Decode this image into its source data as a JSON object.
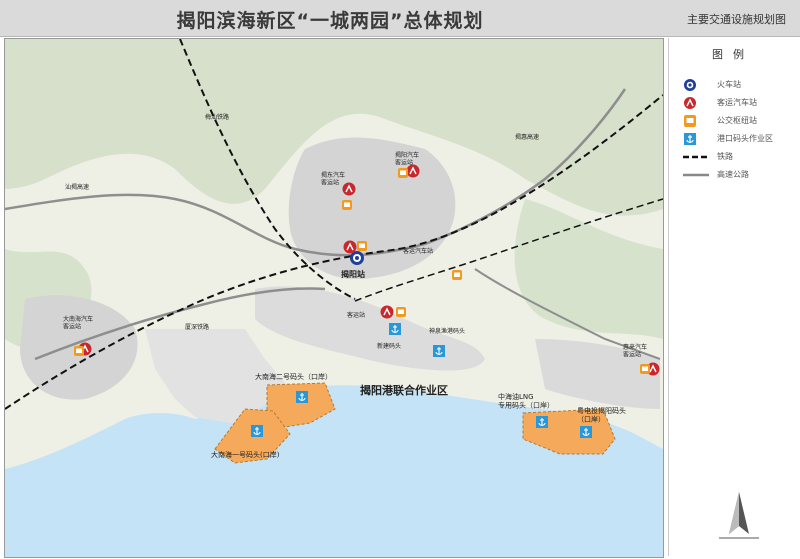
{
  "header": {
    "title": "揭阳滨海新区“一城两园”总体规划",
    "subtitle": "主要交通设施规划图"
  },
  "legend": {
    "title": "图例",
    "items": [
      {
        "id": "rail",
        "label": "火车站",
        "icon": "railway-station-icon",
        "color": "#1f3f9a"
      },
      {
        "id": "bus",
        "label": "客运汽车站",
        "icon": "bus-terminal-icon",
        "color": "#c8282d"
      },
      {
        "id": "public",
        "label": "公交枢纽站",
        "icon": "bus-hub-icon",
        "color": "#f39a1e"
      },
      {
        "id": "port",
        "label": "港口码头作业区",
        "icon": "port-anchor-icon",
        "color": "#2a98d8"
      },
      {
        "id": "railway",
        "label": "铁路",
        "icon": "railway-line-icon",
        "color": "#111111"
      },
      {
        "id": "highway",
        "label": "高速公路",
        "icon": "highway-line-icon",
        "color": "#888888"
      }
    ]
  },
  "map": {
    "colors": {
      "sea": "#c5e3f6",
      "land": "#eef0e6",
      "hills": "#cfdcc4",
      "urban": "#d4d4d4",
      "port_zone": "#f5a95a",
      "rail_station": "#1f3f9a",
      "bus_terminal": "#c8282d",
      "bus_hub": "#f39a1e",
      "port_icon": "#2a98d8"
    },
    "labels": {
      "rail_station": "揭阳站",
      "bus_central": "客运站",
      "bus_north_1": "揭东汽车\n客运站",
      "bus_north_2": "揭阳汽车\n客运站",
      "bus_west": "大南海汽车\n客运站",
      "bus_east": "惠来汽车\n客运站",
      "bus_south": "客运汽车站",
      "port_zone": "揭阳港联合作业区",
      "port_dananhai_2": "大南海二号码头（口岸）",
      "port_dananhai_1": "大南海一号码头(口岸)",
      "port_cnooc": "中海油LNG\n专用码头（口岸）",
      "port_yuedian": "粤电投揭阳码头\n（口岸）",
      "pier_new": "新建码头",
      "pier_shenquan": "神泉渔港码头",
      "highway_1": "汕揭高速",
      "highway_2": "揭惠高速",
      "railway_1": "厦深铁路",
      "railway_2": "梅汕铁路"
    }
  }
}
